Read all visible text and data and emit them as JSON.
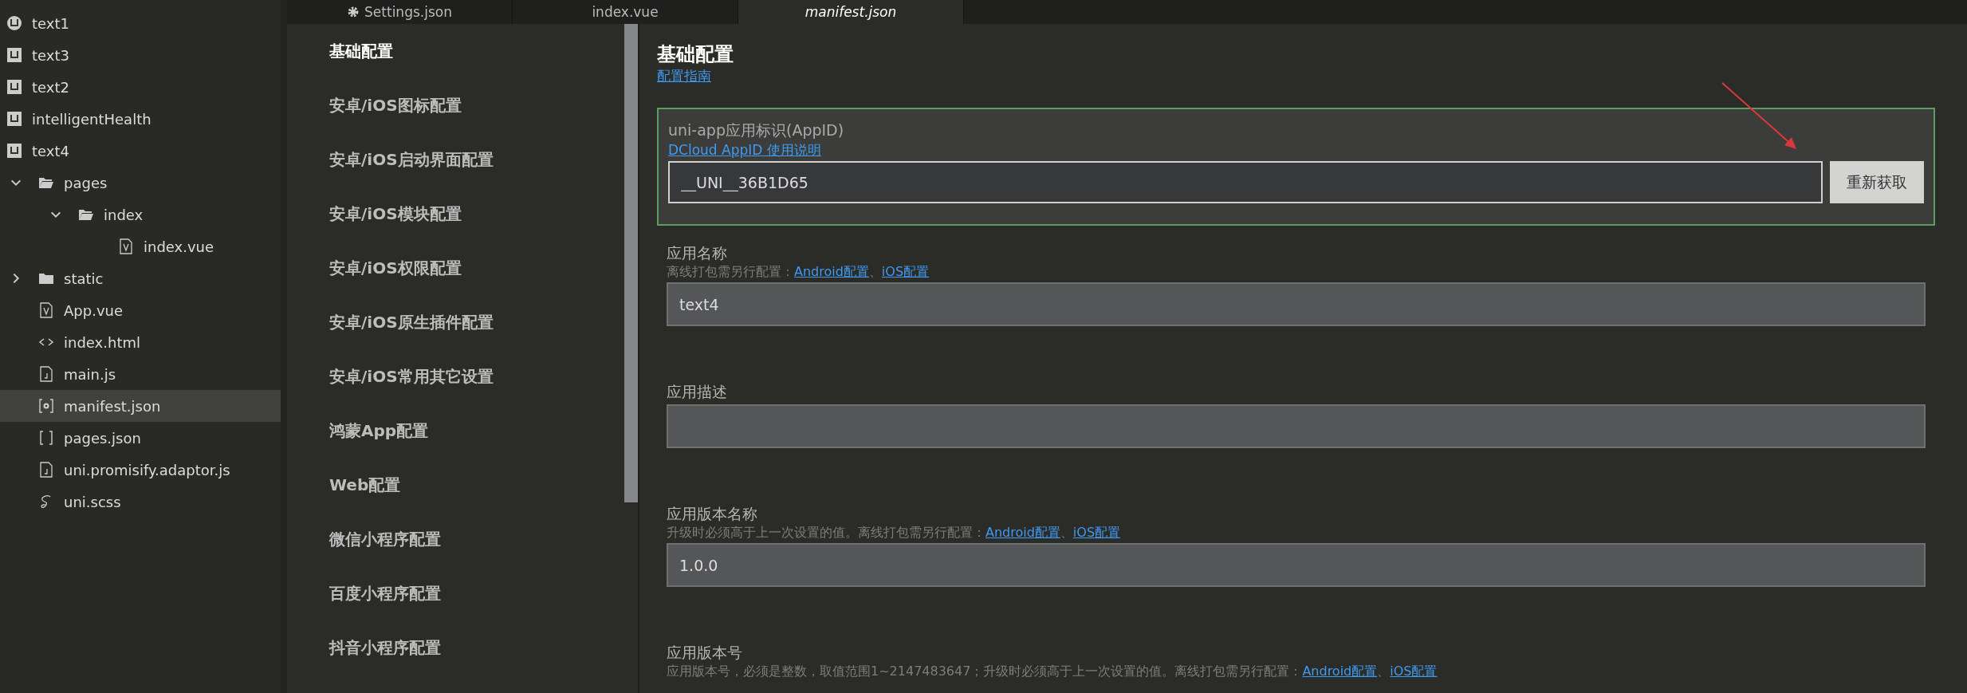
{
  "explorer": {
    "items": [
      {
        "label": "text1",
        "kind": "project-round",
        "selected": false
      },
      {
        "label": "text3",
        "kind": "project",
        "selected": false
      },
      {
        "label": "text2",
        "kind": "project",
        "selected": false
      },
      {
        "label": "intelligentHealth",
        "kind": "project",
        "selected": false
      },
      {
        "label": "text4",
        "kind": "project",
        "selected": false,
        "children": [
          {
            "label": "pages",
            "kind": "folder",
            "expanded": true,
            "selected": false,
            "children": [
              {
                "label": "index",
                "kind": "folder",
                "expanded": true,
                "selected": false,
                "children": [
                  {
                    "label": "index.vue",
                    "kind": "vue",
                    "selected": false
                  }
                ]
              }
            ]
          },
          {
            "label": "static",
            "kind": "folder",
            "expanded": false,
            "selected": false
          },
          {
            "label": "App.vue",
            "kind": "vue",
            "selected": false
          },
          {
            "label": "index.html",
            "kind": "html",
            "selected": false
          },
          {
            "label": "main.js",
            "kind": "js",
            "selected": false
          },
          {
            "label": "manifest.json",
            "kind": "config",
            "selected": true
          },
          {
            "label": "pages.json",
            "kind": "json",
            "selected": false
          },
          {
            "label": "uni.promisify.adaptor.js",
            "kind": "js",
            "selected": false
          },
          {
            "label": "uni.scss",
            "kind": "scss",
            "selected": false
          }
        ]
      }
    ]
  },
  "tabs": [
    {
      "label": "Settings.json",
      "kind": "settings",
      "selected": false
    },
    {
      "label": "index.vue",
      "kind": "file",
      "selected": false
    },
    {
      "label": "manifest.json",
      "kind": "file",
      "selected": true
    }
  ],
  "menu": {
    "items": [
      {
        "label": "基础配置",
        "selected": true
      },
      {
        "label": "安卓/iOS图标配置",
        "selected": false
      },
      {
        "label": "安卓/iOS启动界面配置",
        "selected": false
      },
      {
        "label": "安卓/iOS模块配置",
        "selected": false
      },
      {
        "label": "安卓/iOS权限配置",
        "selected": false
      },
      {
        "label": "安卓/iOS原生插件配置",
        "selected": false
      },
      {
        "label": "安卓/iOS常用其它设置",
        "selected": false
      },
      {
        "label": "鸿蒙App配置",
        "selected": false
      },
      {
        "label": "Web配置",
        "selected": false
      },
      {
        "label": "微信小程序配置",
        "selected": false
      },
      {
        "label": "百度小程序配置",
        "selected": false
      },
      {
        "label": "抖音小程序配置",
        "selected": false
      }
    ]
  },
  "content": {
    "title": "基础配置",
    "guide_link": "配置指南",
    "appid": {
      "label": "uni-app应用标识(AppID)",
      "link": "DCloud AppID 使用说明",
      "value": "__UNI__36B1D65",
      "button": "重新获取"
    },
    "fields": [
      {
        "label": "应用名称",
        "hint": "离线打包需另行配置：",
        "links": [
          "Android配置",
          "iOS配置"
        ],
        "separator": "、",
        "value": "text4"
      },
      {
        "label": "应用描述"
      },
      {
        "label": "应用版本名称",
        "hint": "升级时必须高于上一次设置的值。离线打包需另行配置：",
        "links": [
          "Android配置",
          "iOS配置"
        ],
        "separator": "、",
        "value": "1.0.0"
      },
      {
        "label": "应用版本号",
        "hint": "应用版本号，必须是整数，取值范围1~2147483647；升级时必须高于上一次设置的值。离线打包需另行配置：",
        "links": [
          "Android配置",
          "iOS配置"
        ],
        "separator": "、"
      }
    ]
  }
}
